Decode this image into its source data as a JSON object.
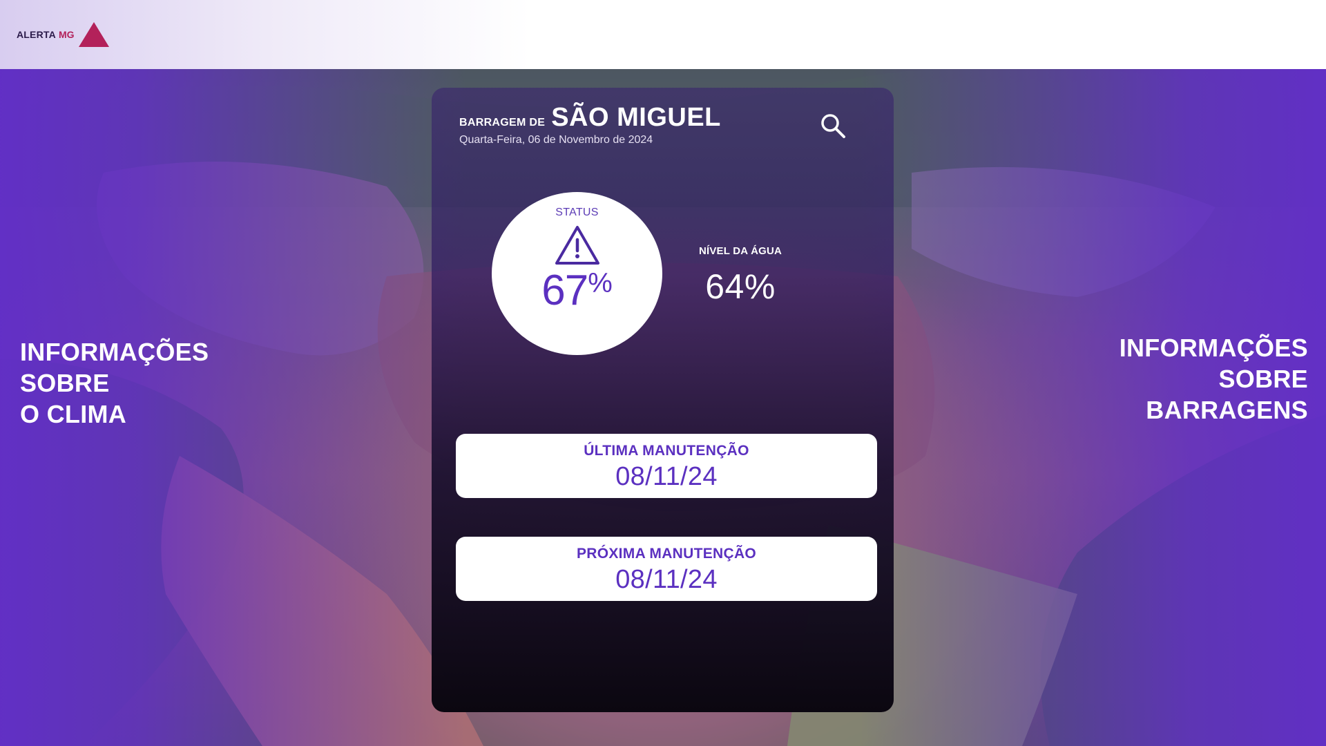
{
  "brand": {
    "name_part1": "ALERTA",
    "name_part2": "MG"
  },
  "colors": {
    "brand_red": "#b3215a",
    "accent_purple": "#5b30c0",
    "overlay_purple": "#622ec8",
    "card_dark": "#0b0710"
  },
  "left_panel": {
    "line1": "INFORMAÇÕES",
    "line2": "SOBRE",
    "line3": "O CLIMA"
  },
  "right_panel": {
    "line1": "INFORMAÇÕES",
    "line2": "SOBRE",
    "line3": "BARRAGENS"
  },
  "dam": {
    "prefix": "BARRAGEM DE",
    "name": "SÃO MIGUEL",
    "date": "Quarta-Feira, 06 de Novembro de 2024",
    "search_icon": "search-icon"
  },
  "status": {
    "label": "STATUS",
    "icon": "warning-icon",
    "value": "67",
    "unit": "%"
  },
  "water_level": {
    "label": "NÍVEL DA ÁGUA",
    "value": "64%"
  },
  "maintenance": {
    "last_title": "ÚLTIMA MANUTENÇÃO",
    "last_date": "08/11/24",
    "next_title": "PRÓXIMA MANUTENÇÃO",
    "next_date": "08/11/24"
  }
}
